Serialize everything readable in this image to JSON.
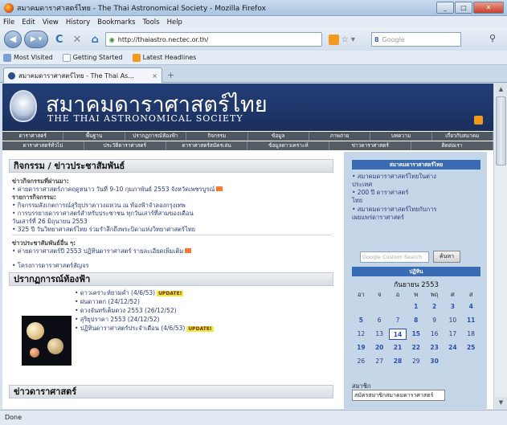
{
  "window": {
    "title": "สมาคมดาราศาสตร์ไทย - The Thai Astronomical Society - Mozilla Firefox"
  },
  "menu": [
    "File",
    "Edit",
    "View",
    "History",
    "Bookmarks",
    "Tools",
    "Help"
  ],
  "toolbar": {
    "back_label": "◀",
    "forward_label": "▶ ▾",
    "reload_icon": "C",
    "stop_icon": "✕",
    "home_icon": "⌂",
    "url": "http://thaiastro.nectec.or.th/",
    "search_placeholder": "Google",
    "search_engine_letter": "8"
  },
  "bookmarks": [
    "Most Visited",
    "Getting Started",
    "Latest Headlines"
  ],
  "tab": {
    "label": "สมาคมดาราศาสตร์ไทย - The Thai As...",
    "close": "×",
    "new": "+"
  },
  "site": {
    "title_th": "สมาคมดาราศาสตร์ไทย",
    "title_en": "THE THAI ASTRONOMICAL SOCIETY"
  },
  "nav_row1": [
    "ดาราศาสตร์",
    "พื้นฐาน",
    "ปรากฏการณ์ท้องฟ้า",
    "กิจกรรม",
    "ข้อมูล",
    "ภาพถ่าย",
    "บทความ",
    "เกี่ยวกับสมาคม"
  ],
  "nav_row2": [
    "ดาราศาสตร์ทั่วไป",
    "ประวัติดาราศาสตร์",
    "ดาราศาสตร์สมัครเล่น",
    "ข้อมูลดาวเคราะห์",
    "ข่าวดาราศาสตร์",
    "ติดต่อเรา"
  ],
  "main": {
    "activities_title": "กิจกรรม / ข่าวประชาสัมพันธ์",
    "planets_title": "ปรากฏการณ์ท้องฟ้า",
    "news_title": "ข่าวดาราศาสตร์",
    "activity_lines": [
      "• ค่ายดาราศาสตร์ภาคฤดูหนาว วันที่ 9-10 กุมภาพันธ์ 2553 จังหวัดเพชรบูรณ์",
      "• กิจกรรมสังเกตการณ์สุริยุปราคาวงแหวน ณ ท้องฟ้าจำลองกรุงเทพ",
      "• การบรรยายดาราศาสตร์สำหรับประชาชน ทุกวันเสาร์ที่สามของเดือน",
      "  วันเสาร์ที่ 26 มิถุนายน 2553",
      "• 325 ปี วันวิทยาศาสตร์ไทย ร่วมรำลึกถึงพระบิดาแห่งวิทยาศาสตร์ไทย",
      "• ค่ายดาราศาสตร์ปี 2553 ปฏิทินดาราศาสตร์ รายละเอียดเพิ่มเติม",
      "• โครงการดาราศาสตร์สัญจร"
    ],
    "activity_headings": [
      "ข่าวกิจกรรมที่ผ่านมา:",
      "รายการกิจกรรม:",
      "ข่าวประชาสัมพันธ์อื่น ๆ:"
    ],
    "new_tag": "UPDATE!",
    "planet_lines": [
      "• ดาวเคราะห์ยามค่ำ (4/6/53)",
      "• ฝนดาวตก (24/12/52)",
      "• ดวงจันทร์เต็มดวง 2553 (26/12/52)",
      "• สุริยุปราคา 2553 (24/12/52)",
      "• ปฏิทินดาราศาสตร์ประจำเดือน (4/6/53)"
    ]
  },
  "sidebar": {
    "box1_title": "สมาคมดาราศาสตร์ไทย",
    "box1_lines": [
      "• สมาคมดาราศาสตร์ไทยในต่าง",
      "  ประเทศ",
      "• 200 ปี ดาราศาสตร์",
      "  ไทย",
      "• สมาคมดาราศาสตร์ไทยกับการ",
      "  เผยแพร่ดาราศาสตร์"
    ],
    "search_placeholder": "Google Custom Search",
    "search_button": "ค้นหา",
    "calendar_title": "ปฏิทิน",
    "calendar_month": "กันยายน 2553",
    "calendar_days": [
      "อา",
      "จ",
      "อ",
      "พ",
      "พฤ",
      "ศ",
      "ส"
    ],
    "calendar_weeks": [
      [
        "",
        "",
        "",
        "1",
        "2",
        "3",
        "4"
      ],
      [
        "5",
        "6",
        "7",
        "8",
        "9",
        "10",
        "11"
      ],
      [
        "12",
        "13",
        "14",
        "15",
        "16",
        "17",
        "18"
      ],
      [
        "19",
        "20",
        "21",
        "22",
        "23",
        "24",
        "25"
      ],
      [
        "26",
        "27",
        "28",
        "29",
        "30",
        "",
        ""
      ]
    ],
    "calendar_links": [
      "1",
      "2",
      "3",
      "4",
      "5",
      "8",
      "11",
      "15",
      "19",
      "20",
      "21",
      "22",
      "23",
      "24",
      "25",
      "28",
      "30"
    ],
    "calendar_today": "14",
    "etc_label": "สมาชิก",
    "etc_value": "สมัครสมาชิกสมาคมดาราศาสตร์"
  },
  "status": "Done",
  "colors": {
    "header_bg": "#1d3466",
    "nav_bg": "#4f5860",
    "sidebar_bg": "#c6d6e9",
    "link": "#2a3a78",
    "update_tag": "#f2ea3c"
  }
}
